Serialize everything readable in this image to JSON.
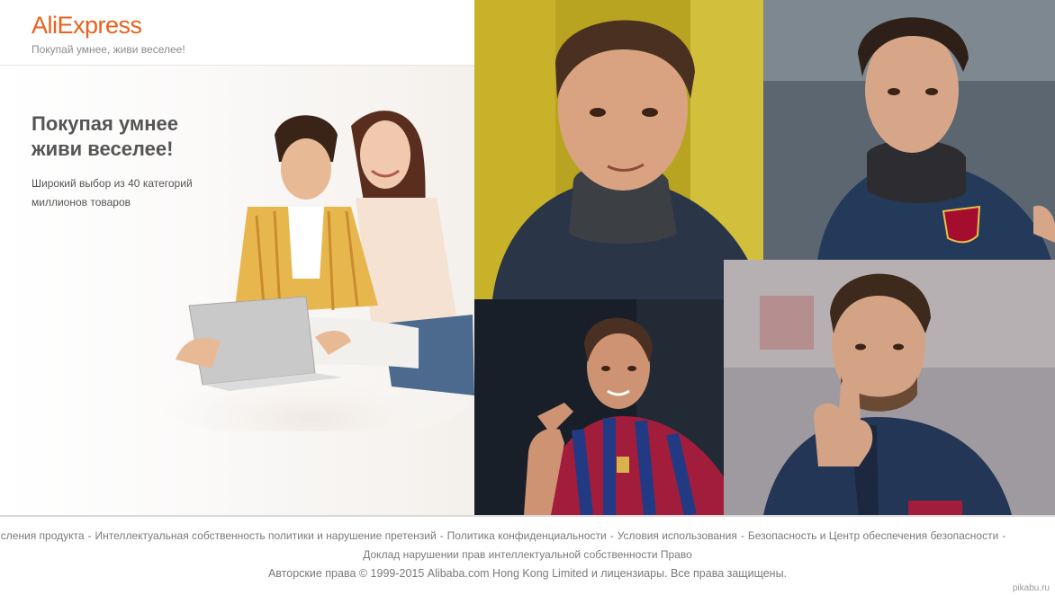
{
  "header": {
    "logo_part1": "Ali",
    "logo_part2": "Express",
    "slogan": "Покупай умнее, живи веселее!"
  },
  "promo": {
    "headline_line1": "Покупая умнее",
    "headline_line2": "живи веселее!",
    "sub_line1": "Широкий выбор из 40 категорий",
    "sub_line2": "миллионов товаров"
  },
  "footer": {
    "links": [
      "исления продукта",
      "Интеллектуальная собственность политики и нарушение претензий",
      "Политика конфиденциальности",
      "Условия использования",
      "Безопасность и Центр обеспечения безопасности"
    ],
    "trailing_separator": "-",
    "line2": "Доклад нарушении прав интеллектуальной собственности Право",
    "line3": "Авторские права © 1999-2015 Alibaba.com Hong Kong Limited и лицензиары. Все права защищены."
  },
  "watermark": "pikabu.ru",
  "colors": {
    "brand_orange": "#e8611d",
    "text_gray": "#7a7a7a",
    "headline_gray": "#555555"
  }
}
